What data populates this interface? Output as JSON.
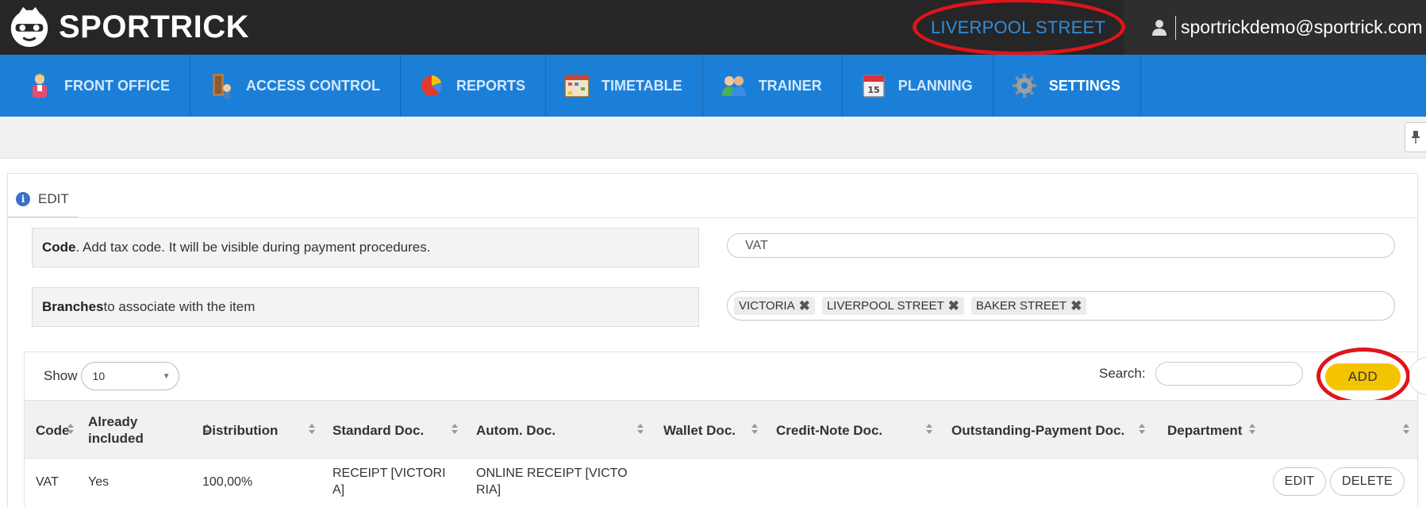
{
  "app": {
    "logo_text": "SPORTRICK",
    "logo_icon": "sportrick-logo-icon"
  },
  "header": {
    "branch": "LIVERPOOL STREET",
    "user_email": "sportrickdemo@sportrick.com",
    "user_icon": "user-icon"
  },
  "nav": {
    "items": [
      {
        "label": "FRONT OFFICE",
        "icon": "receptionist-icon"
      },
      {
        "label": "ACCESS CONTROL",
        "icon": "turnstile-icon"
      },
      {
        "label": "REPORTS",
        "icon": "pie-chart-icon"
      },
      {
        "label": "TIMETABLE",
        "icon": "timetable-icon"
      },
      {
        "label": "TRAINER",
        "icon": "trainer-icon"
      },
      {
        "label": "PLANNING",
        "icon": "calendar-icon"
      },
      {
        "label": "SETTINGS",
        "icon": "gear-icon"
      }
    ],
    "active": "SETTINGS"
  },
  "panel": {
    "tab_label": "EDIT",
    "code": {
      "label_bold": "Code",
      "label_rest": ". Add tax code. It will be visible during payment procedures.",
      "value": "VAT"
    },
    "branches": {
      "label_bold": "Branches",
      "label_rest": " to associate with the item",
      "tags": [
        "VICTORIA",
        "LIVERPOOL STREET",
        "BAKER STREET"
      ],
      "remove_glyph": "✖"
    }
  },
  "table": {
    "show_label": "Show",
    "show_value": "10",
    "search_label": "Search:",
    "add_label": "ADD",
    "columns": [
      "Code",
      "Already included",
      "Distribution",
      "Standard Doc.",
      "Autom. Doc.",
      "Wallet Doc.",
      "Credit-Note Doc.",
      "Outstanding-Payment Doc.",
      "Department"
    ],
    "rows": [
      {
        "code": "VAT",
        "already_included": "Yes",
        "distribution": "100,00%",
        "standard_doc": "RECEIPT [VICTORI A]",
        "autom_doc": "ONLINE RECEIPT [VICTO RIA]",
        "wallet_doc": "",
        "credit_note_doc": "",
        "outstanding_payment_doc": "",
        "department": "",
        "edit_label": "EDIT",
        "delete_label": "DELETE"
      }
    ]
  },
  "colors": {
    "nav_bg": "#1b7fd8",
    "topbar_bg": "#262626",
    "branch_text": "#2d8ee0",
    "add_button": "#f5c400",
    "highlight_circle": "#e0141b"
  }
}
